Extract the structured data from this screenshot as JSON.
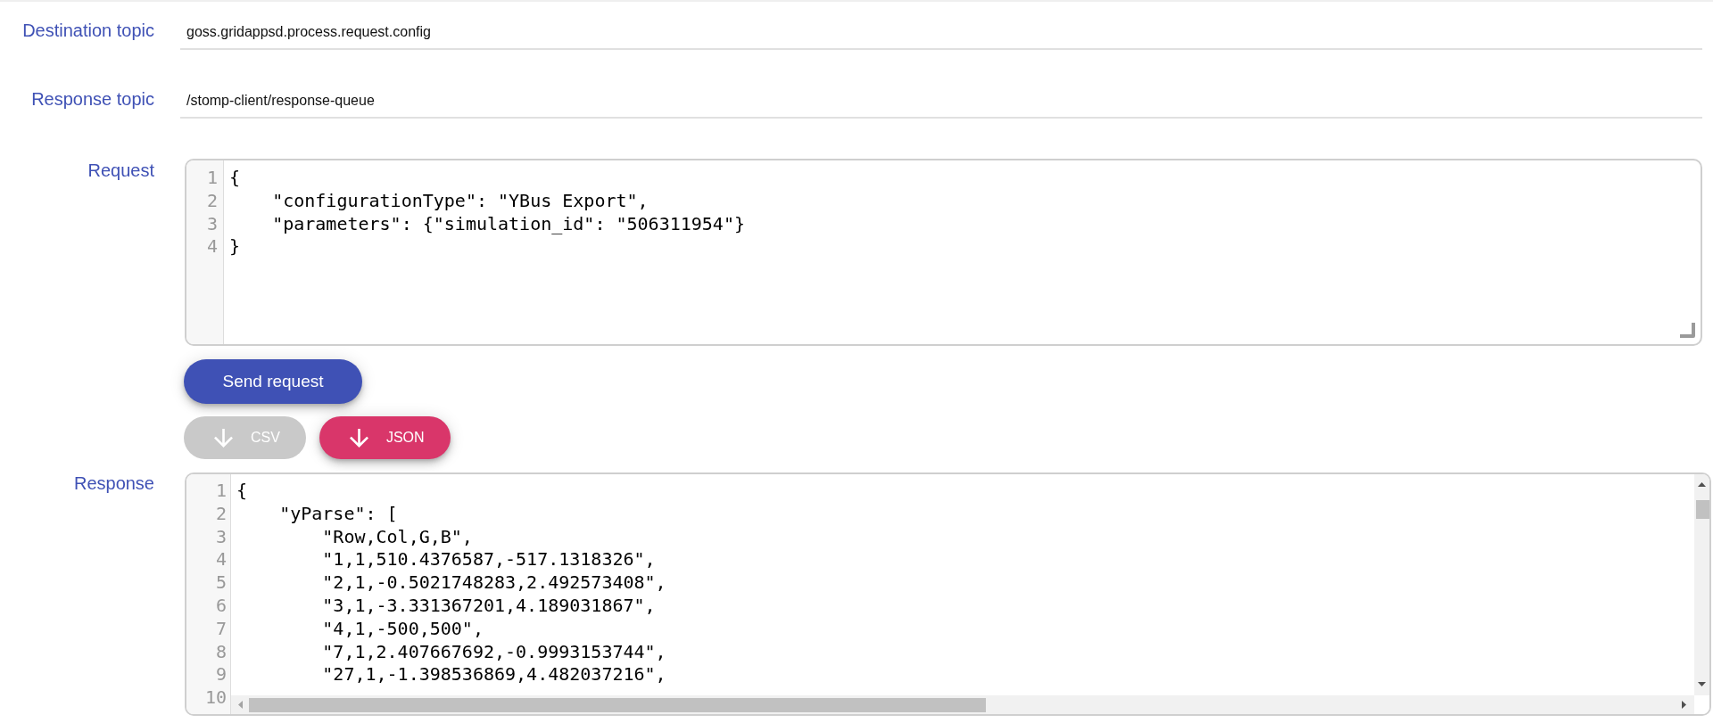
{
  "fields": [
    {
      "label": "Destination topic",
      "value": "goss.gridappsd.process.request.config"
    },
    {
      "label": "Response topic",
      "value": "/stomp-client/response-queue"
    }
  ],
  "request": {
    "label": "Request",
    "lines": [
      {
        "number": "1",
        "code": "{"
      },
      {
        "number": "2",
        "code": "    \"configurationType\": \"YBus Export\","
      },
      {
        "number": "3",
        "code": "    \"parameters\": {\"simulation_id\": \"506311954\"}"
      },
      {
        "number": "4",
        "code": "}"
      }
    ]
  },
  "send_button": {
    "label": "Send request"
  },
  "download_buttons": [
    {
      "label": "CSV",
      "disabled": true
    },
    {
      "label": "JSON",
      "disabled": false
    }
  ],
  "response": {
    "label": "Response",
    "lines": [
      {
        "number": "1",
        "code": "{"
      },
      {
        "number": "2",
        "code": "    \"yParse\": ["
      },
      {
        "number": "3",
        "code": "        \"Row,Col,G,B\","
      },
      {
        "number": "4",
        "code": "        \"1,1,510.4376587,-517.1318326\","
      },
      {
        "number": "5",
        "code": "        \"2,1,-0.5021748283,2.492573408\","
      },
      {
        "number": "6",
        "code": "        \"3,1,-3.331367201,4.189031867\","
      },
      {
        "number": "7",
        "code": "        \"4,1,-500,500\","
      },
      {
        "number": "8",
        "code": "        \"7,1,2.407667692,-0.9993153744\","
      },
      {
        "number": "9",
        "code": "        \"27,1,-1.398536869,4.482037216\","
      },
      {
        "number": "10"
      }
    ]
  }
}
